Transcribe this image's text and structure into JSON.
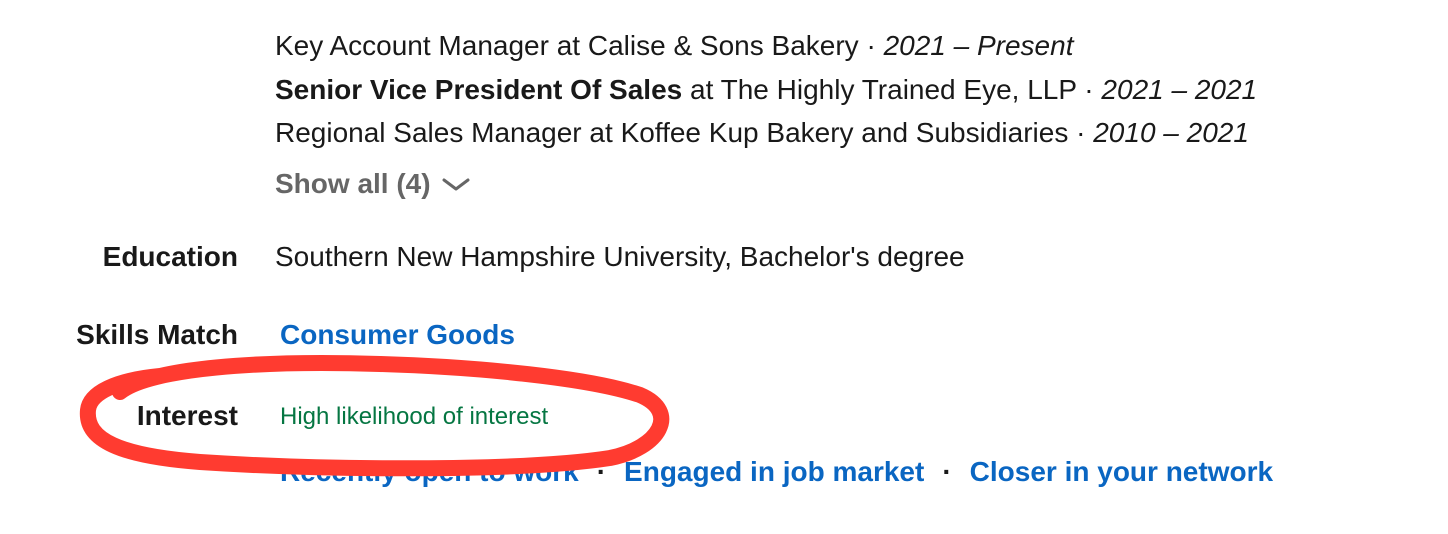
{
  "experience": {
    "items": [
      {
        "role": "Key Account Manager",
        "bold": false,
        "connector": " at ",
        "company": "Calise & Sons Bakery",
        "dates": "2021 – Present"
      },
      {
        "role": "Senior Vice President Of Sales",
        "bold": true,
        "connector": " at ",
        "company": "The Highly Trained Eye, LLP",
        "dates": "2021 – 2021"
      },
      {
        "role": "Regional Sales Manager",
        "bold": false,
        "connector": " at ",
        "company": "Koffee Kup Bakery and Subsidiaries",
        "dates": "2010 – 2021"
      }
    ],
    "separator": " · ",
    "show_all_label": "Show all (4)"
  },
  "education": {
    "label": "Education",
    "value": "Southern New Hampshire University, Bachelor's degree"
  },
  "skills": {
    "label": "Skills Match",
    "value": "Consumer Goods"
  },
  "interest": {
    "label": "Interest",
    "value": "High likelihood of interest"
  },
  "signals": [
    "Recently open to work",
    "Engaged in job market",
    "Closer in your network"
  ],
  "signal_separator": "·",
  "colors": {
    "link": "#0a66c2",
    "interest": "#057642",
    "muted": "#666666",
    "annotation": "#ff3b30"
  },
  "icons": {
    "show_all": "chevron-down-icon"
  }
}
